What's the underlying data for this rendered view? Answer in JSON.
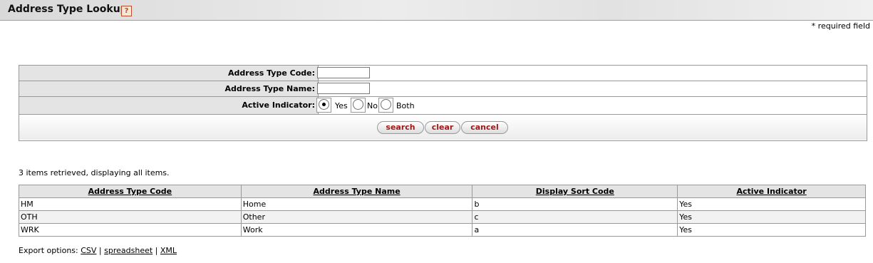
{
  "header": {
    "title": "Address Type Lookup",
    "help_icon": "?"
  },
  "required_note": "* required field",
  "criteria": {
    "fields": [
      {
        "label": "Address Type Code:",
        "value": ""
      },
      {
        "label": "Address Type Name:",
        "value": ""
      }
    ],
    "active": {
      "label": "Active Indicator:",
      "options": [
        "Yes",
        "No",
        "Both"
      ],
      "selected": "Yes"
    },
    "buttons": {
      "search": "search",
      "clear": "clear",
      "cancel": "cancel"
    }
  },
  "results": {
    "summary": "3 items retrieved, displaying all items.",
    "columns": [
      "Address Type Code",
      "Address Type Name",
      "Display Sort Code",
      "Active Indicator"
    ],
    "rows": [
      [
        "HM",
        "Home",
        "b",
        "Yes"
      ],
      [
        "OTH",
        "Other",
        "c",
        "Yes"
      ],
      [
        "WRK",
        "Work",
        "a",
        "Yes"
      ]
    ]
  },
  "export": {
    "label": "Export options:",
    "options": [
      "CSV",
      "spreadsheet",
      "XML"
    ]
  }
}
